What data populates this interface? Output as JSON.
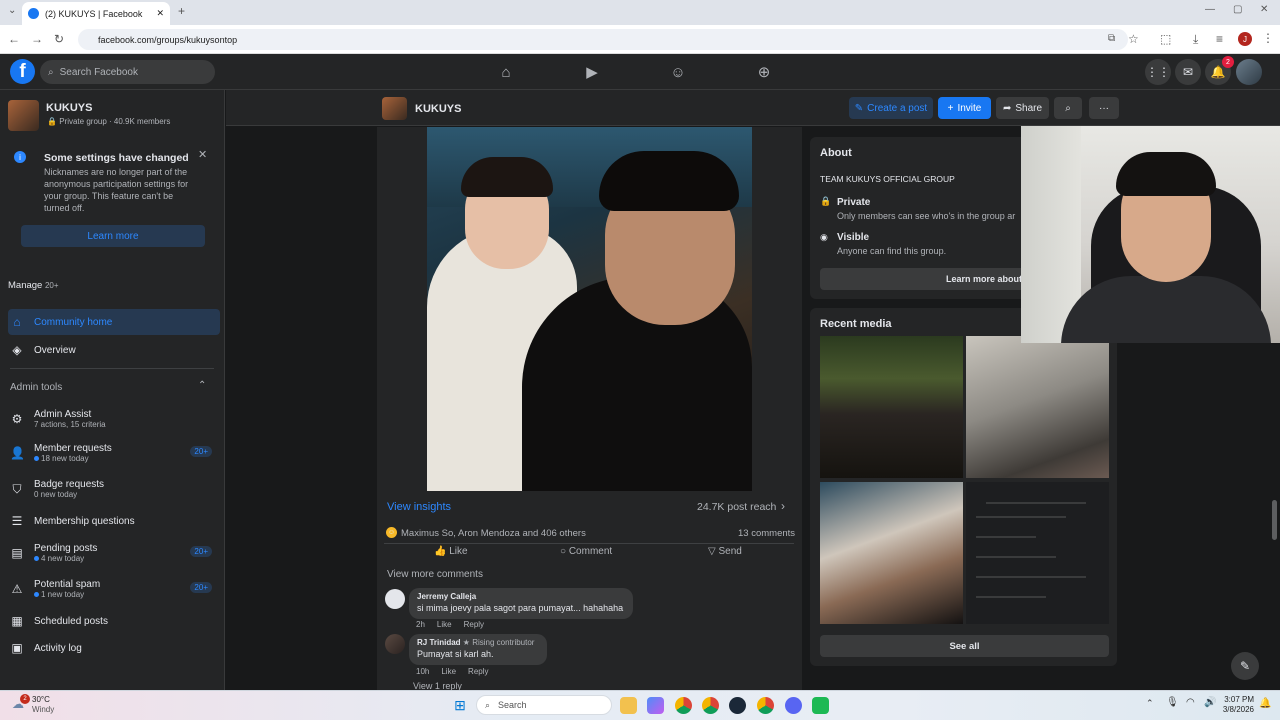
{
  "browser": {
    "tab_title": "(2) KUKUYS | Facebook",
    "url": "facebook.com/groups/kukuysontop",
    "profile_initial": "J"
  },
  "fb": {
    "logo": "f",
    "search_placeholder": "Search Facebook",
    "notif_count": "2"
  },
  "sidebar": {
    "group_name": "KUKUYS",
    "group_meta": "Private group · 40.9K members",
    "notice": {
      "title": "Some settings have changed",
      "body": "Nicknames are no longer part of the anonymous participation settings for your group. This feature can't be turned off.",
      "button": "Learn more"
    },
    "manage_label": "Manage",
    "manage_count": "20+",
    "nav": [
      {
        "label": "Community home"
      },
      {
        "label": "Overview"
      }
    ],
    "admin_tools_label": "Admin tools",
    "admin_items": [
      {
        "label": "Admin Assist",
        "sub": "7 actions, 15 criteria",
        "badge": ""
      },
      {
        "label": "Member requests",
        "sub": "18 new today",
        "badge": "20+"
      },
      {
        "label": "Badge requests",
        "sub": "0 new today",
        "badge": ""
      },
      {
        "label": "Membership questions",
        "sub": "",
        "badge": ""
      },
      {
        "label": "Pending posts",
        "sub": "4 new today",
        "badge": "20+"
      },
      {
        "label": "Potential spam",
        "sub": "1 new today",
        "badge": "20+"
      },
      {
        "label": "Scheduled posts",
        "sub": "",
        "badge": ""
      },
      {
        "label": "Activity log",
        "sub": "",
        "badge": ""
      }
    ]
  },
  "subhead": {
    "group_name": "KUKUYS",
    "create_post": "Create a post",
    "invite": "Invite",
    "share": "Share"
  },
  "post": {
    "view_insights": "View insights",
    "reach": "24.7K post reach",
    "reactions": "Maximus So, Aron Mendoza and 406 others",
    "comments_count": "13 comments",
    "like": "Like",
    "comment": "Comment",
    "send": "Send",
    "view_more": "View more comments",
    "comments": [
      {
        "author": "Jerremy Calleja",
        "text": "si mima joevy pala sagot para pumayat... hahahaha",
        "time": "2h",
        "badge": ""
      },
      {
        "author": "RJ Trinidad",
        "text": "Pumayat si karl ah.",
        "time": "10h",
        "badge": "Rising contributor"
      }
    ],
    "like_action": "Like",
    "reply_action": "Reply",
    "view_reply": "View 1 reply"
  },
  "about": {
    "title": "About",
    "desc": "TEAM KUKUYS OFFICIAL GROUP",
    "private_title": "Private",
    "private_desc": "Only members can see who's in the group ar",
    "visible_title": "Visible",
    "visible_desc": "Anyone can find this group.",
    "learn_more": "Learn more about this grou"
  },
  "media": {
    "title": "Recent media",
    "see_all": "See all"
  },
  "taskbar": {
    "temp": "30°C",
    "weather": "Windy",
    "weather_badge": "2",
    "search": "Search",
    "time": "3:07 PM",
    "date": "3/8/2026"
  }
}
